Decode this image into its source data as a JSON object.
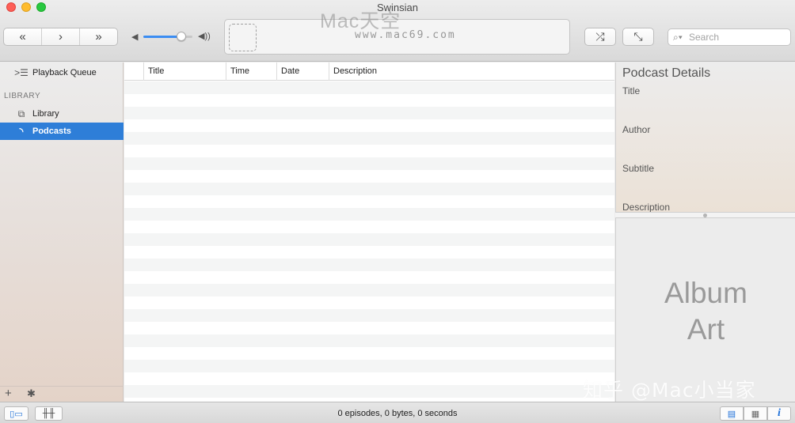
{
  "window": {
    "title": "Swinsian"
  },
  "toolbar": {
    "prev_icon": "double-chevron-left-icon",
    "play_icon": "chevron-right-icon",
    "next_icon": "double-chevron-right-icon",
    "prev_glyph": "«",
    "play_glyph": "›",
    "next_glyph": "»",
    "volume_level": 0.8,
    "search_placeholder": "Search",
    "watermark": "Mac天空",
    "watermark_url": "www.mac69.com"
  },
  "sidebar": {
    "playback_queue_label": "Playback Queue",
    "section_header": "LIBRARY",
    "items": [
      {
        "label": "Library",
        "icon": "library-icon",
        "selected": false
      },
      {
        "label": "Podcasts",
        "icon": "podcast-icon",
        "selected": true
      }
    ]
  },
  "table": {
    "columns": [
      "Title",
      "Time",
      "Date",
      "Description"
    ],
    "rows": []
  },
  "details": {
    "title": "Podcast Details",
    "fields": [
      "Title",
      "Author",
      "Subtitle",
      "Description"
    ]
  },
  "album_art": {
    "line1": "Album",
    "line2": "Art"
  },
  "overlay_watermark": "知乎 @Mac小当家",
  "status": {
    "summary": "0 episodes,  0 bytes,  0 seconds"
  },
  "colors": {
    "accent": "#2e7ed8",
    "volume": "#3b8df2"
  }
}
